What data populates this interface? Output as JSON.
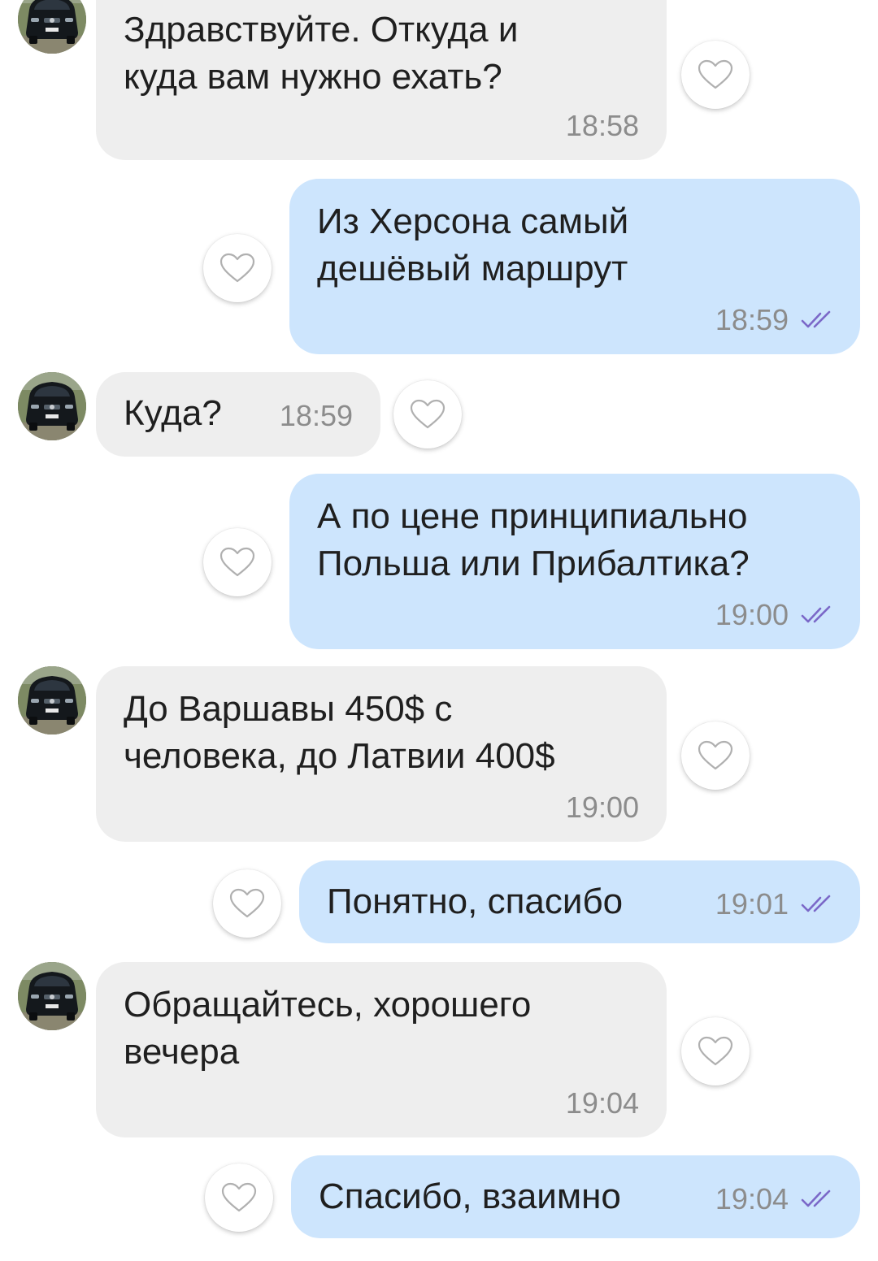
{
  "colors": {
    "incoming_bubble": "#eeeeee",
    "outgoing_bubble": "#cde5fd",
    "read_check": "#7b68c8",
    "heart_outline": "#b0b0b0"
  },
  "contact": {
    "avatar_icon": "minivan-photo-avatar"
  },
  "messages": [
    {
      "direction": "incoming",
      "text": "Здравствуйте. Откуда и\nкуда вам нужно ехать?",
      "time": "18:58"
    },
    {
      "direction": "outgoing",
      "text": "Из Херсона самый\nдешёвый маршрут",
      "time": "18:59",
      "status_icon": "double-check-icon"
    },
    {
      "direction": "incoming",
      "text": "Куда?",
      "time": "18:59"
    },
    {
      "direction": "outgoing",
      "text": "А по цене принципиально\nПольша или Прибалтика?",
      "time": "19:00",
      "status_icon": "double-check-icon"
    },
    {
      "direction": "incoming",
      "text": "До Варшавы 450$ с\nчеловека, до Латвии 400$",
      "time": "19:00"
    },
    {
      "direction": "outgoing",
      "text": "Понятно, спасибо",
      "time": "19:01",
      "status_icon": "double-check-icon"
    },
    {
      "direction": "incoming",
      "text": "Обращайтесь, хорошего\nвечера",
      "time": "19:04"
    },
    {
      "direction": "outgoing",
      "text": "Спасибо, взаимно",
      "time": "19:04",
      "status_icon": "double-check-icon"
    }
  ]
}
